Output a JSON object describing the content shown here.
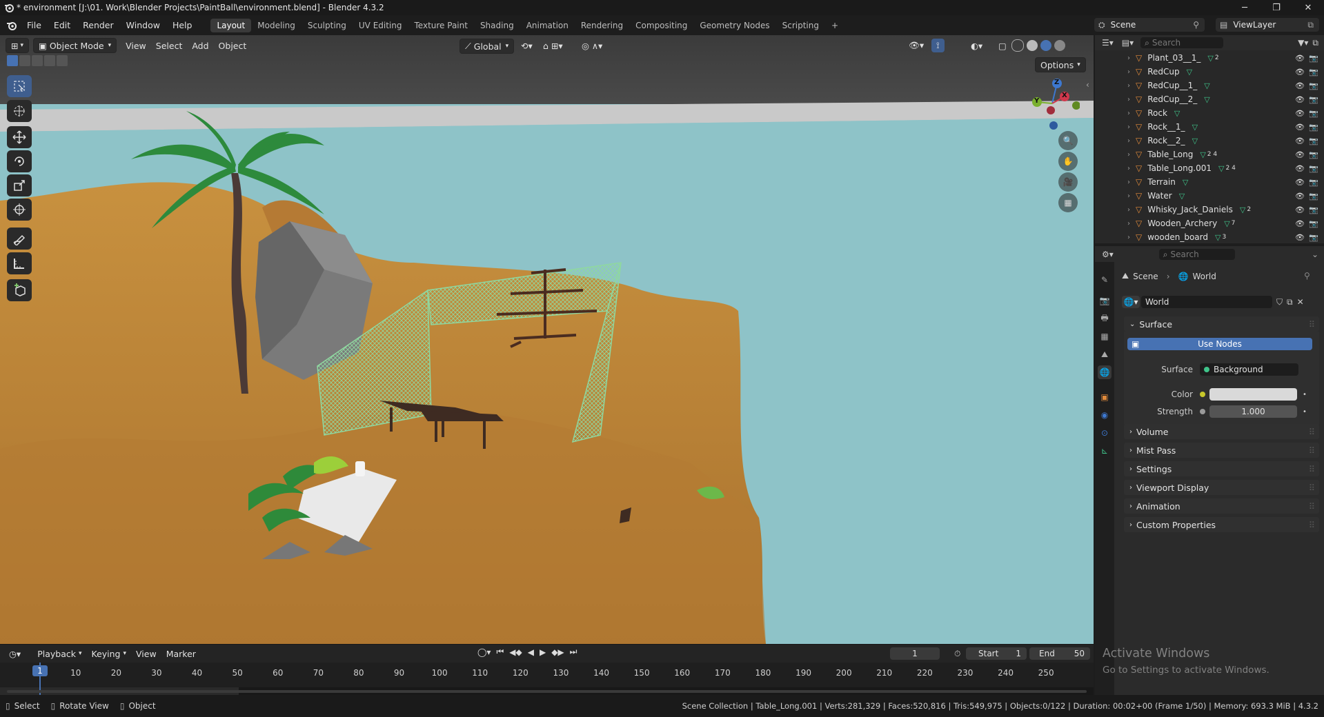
{
  "window": {
    "title": "* environment [J:\\01. Work\\Blender Projects\\PaintBall\\environment.blend] - Blender 4.3.2",
    "min": "─",
    "max": "❐",
    "close": "✕"
  },
  "menubar": {
    "items": [
      "File",
      "Edit",
      "Render",
      "Window",
      "Help"
    ],
    "workspaces": [
      "Layout",
      "Modeling",
      "Sculpting",
      "UV Editing",
      "Texture Paint",
      "Shading",
      "Animation",
      "Rendering",
      "Compositing",
      "Geometry Nodes",
      "Scripting"
    ],
    "active_workspace": "Layout",
    "add": "+",
    "scene": "Scene",
    "view_layer": "ViewLayer"
  },
  "viewport_header": {
    "mode": "Object Mode",
    "menus": [
      "View",
      "Select",
      "Add",
      "Object"
    ],
    "orientation": "Global",
    "options": "Options"
  },
  "gizmo": {
    "z": "Z",
    "y": "Y",
    "x": "X"
  },
  "outliner": {
    "search_placeholder": "Search",
    "rows": [
      {
        "name": "Plant_03__1_",
        "badge": "2"
      },
      {
        "name": "RedCup",
        "badge": ""
      },
      {
        "name": "RedCup__1_",
        "badge": ""
      },
      {
        "name": "RedCup__2_",
        "badge": ""
      },
      {
        "name": "Rock",
        "badge": ""
      },
      {
        "name": "Rock__1_",
        "badge": ""
      },
      {
        "name": "Rock__2_",
        "badge": ""
      },
      {
        "name": "Table_Long",
        "badge": "2 4"
      },
      {
        "name": "Table_Long.001",
        "badge": "2 4"
      },
      {
        "name": "Terrain",
        "badge": ""
      },
      {
        "name": "Water",
        "badge": ""
      },
      {
        "name": "Whisky_Jack_Daniels",
        "badge": "2"
      },
      {
        "name": "Wooden_Archery",
        "badge": "7"
      },
      {
        "name": "wooden_board",
        "badge": "3"
      }
    ]
  },
  "properties": {
    "search_placeholder": "Search",
    "breadcrumb": [
      "Scene",
      "World"
    ],
    "world_name": "World",
    "surface_panel": "Surface",
    "use_nodes": "Use Nodes",
    "surface_label": "Surface",
    "surface_value": "Background",
    "color_label": "Color",
    "strength_label": "Strength",
    "strength_value": "1.000",
    "color_hex": "#d9d9d9",
    "panels": [
      "Volume",
      "Mist Pass",
      "Settings",
      "Viewport Display",
      "Animation",
      "Custom Properties"
    ]
  },
  "timeline": {
    "menus": [
      "Playback",
      "Keying",
      "View",
      "Marker"
    ],
    "current_frame": "1",
    "start_label": "Start",
    "start": "1",
    "end_label": "End",
    "end": "50",
    "ticks": [
      "1",
      "10",
      "20",
      "30",
      "40",
      "50",
      "60",
      "70",
      "80",
      "90",
      "100",
      "110",
      "120",
      "130",
      "140",
      "150",
      "160",
      "170",
      "180",
      "190",
      "200",
      "210",
      "220",
      "230",
      "240",
      "250"
    ]
  },
  "statusbar": {
    "select": "Select",
    "rotate": "Rotate View",
    "object": "Object",
    "info": "Scene Collection | Table_Long.001 | Verts:281,329 | Faces:520,816 | Tris:549,975 | Objects:0/122 | Duration: 00:02+00 (Frame 1/50) | Memory: 693.3 MiB | 4.3.2"
  },
  "watermark": {
    "title": "Activate Windows",
    "subtitle": "Go to Settings to activate Windows."
  },
  "colors": {
    "accent": "#4772b3",
    "object_orange": "#e08a3b",
    "mesh_green": "#3fc48a"
  }
}
